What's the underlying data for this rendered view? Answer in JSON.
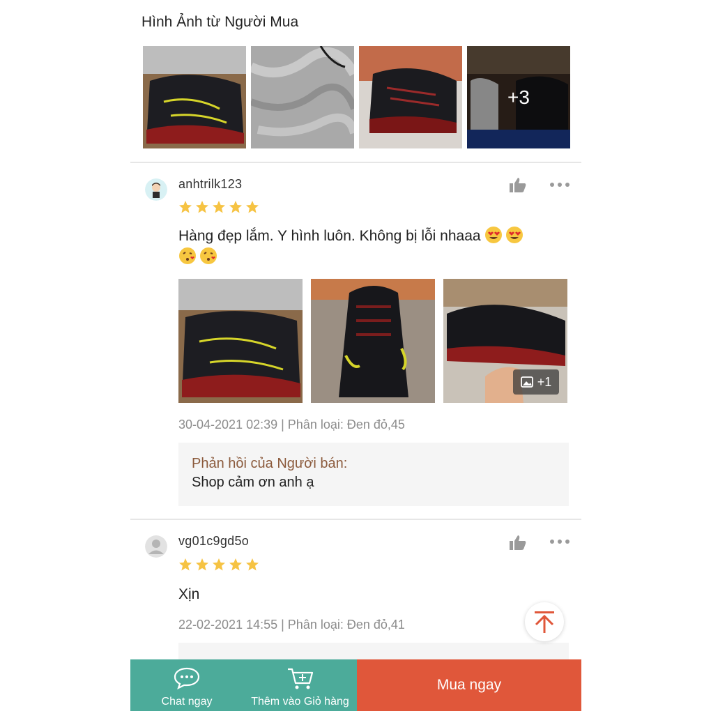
{
  "colors": {
    "star": "#f6c343",
    "bottom_teal": "#4cab9a",
    "buy_orange": "#e0573a",
    "seller_label": "#8b5a3c",
    "scroll_arrow": "#e0573a"
  },
  "buyer_photos": {
    "title": "Hình Ảnh từ Người Mua",
    "more_count": "+3"
  },
  "reviews": [
    {
      "username": "anhtrilk123",
      "rating": 5,
      "text": "Hàng đẹp lắm. Y hình luôn. Không bị lỗi nhaaa",
      "emojis": [
        "heart-eyes",
        "heart-eyes",
        "kiss",
        "kiss"
      ],
      "photo_extra_count": "+1",
      "meta": "30-04-2021 02:39 | Phân loại: Đen đỏ,45",
      "seller_reply": {
        "label": "Phản hồi của Người bán:",
        "text": "Shop cảm ơn anh ạ"
      }
    },
    {
      "username": "vg01c9gd5o",
      "rating": 5,
      "text": "Xịn",
      "meta": "22-02-2021 14:55 | Phân loại: Đen đỏ,41"
    }
  ],
  "bottom_bar": {
    "chat_label": "Chat ngay",
    "cart_label": "Thêm vào Giỏ hàng",
    "buy_label": "Mua ngay"
  }
}
